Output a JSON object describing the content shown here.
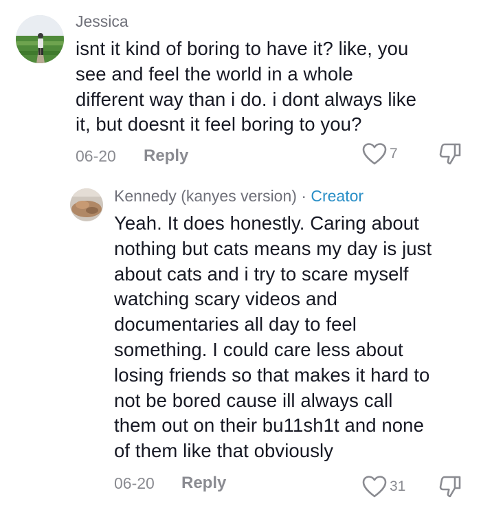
{
  "comments": [
    {
      "author": "Jessica",
      "text_lines": [
        "isnt it kind of boring to have it? like, you",
        "see and feel the world in a whole",
        "different way than i do. i dont always like",
        "it, but doesnt it feel boring to you?"
      ],
      "date": "06-20",
      "reply_label": "Reply",
      "likes": "7",
      "avatar_icon": "profile-photo-field",
      "like_icon": "heart-outline-icon",
      "dislike_icon": "thumbs-down-icon"
    },
    {
      "author": "Kennedy (kanyes version)",
      "separator": "·",
      "badge": "Creator",
      "text_lines": [
        "Yeah. It does honestly. Caring about",
        "nothing but cats means my day is just",
        "about cats and i try to scare myself",
        "watching scary videos and",
        "documentaries all day to feel",
        "something. I could care less about",
        "losing friends so that makes it hard to",
        "not be bored cause ill always call",
        "them out on their bu11sh1t and none",
        "of them like that obviously"
      ],
      "date": "06-20",
      "reply_label": "Reply",
      "likes": "31",
      "avatar_icon": "profile-photo-cat",
      "like_icon": "heart-outline-icon",
      "dislike_icon": "thumbs-down-icon"
    }
  ],
  "colors": {
    "text": "#161823",
    "meta": "#8a8b91",
    "creator_badge": "#2a8fc7"
  }
}
